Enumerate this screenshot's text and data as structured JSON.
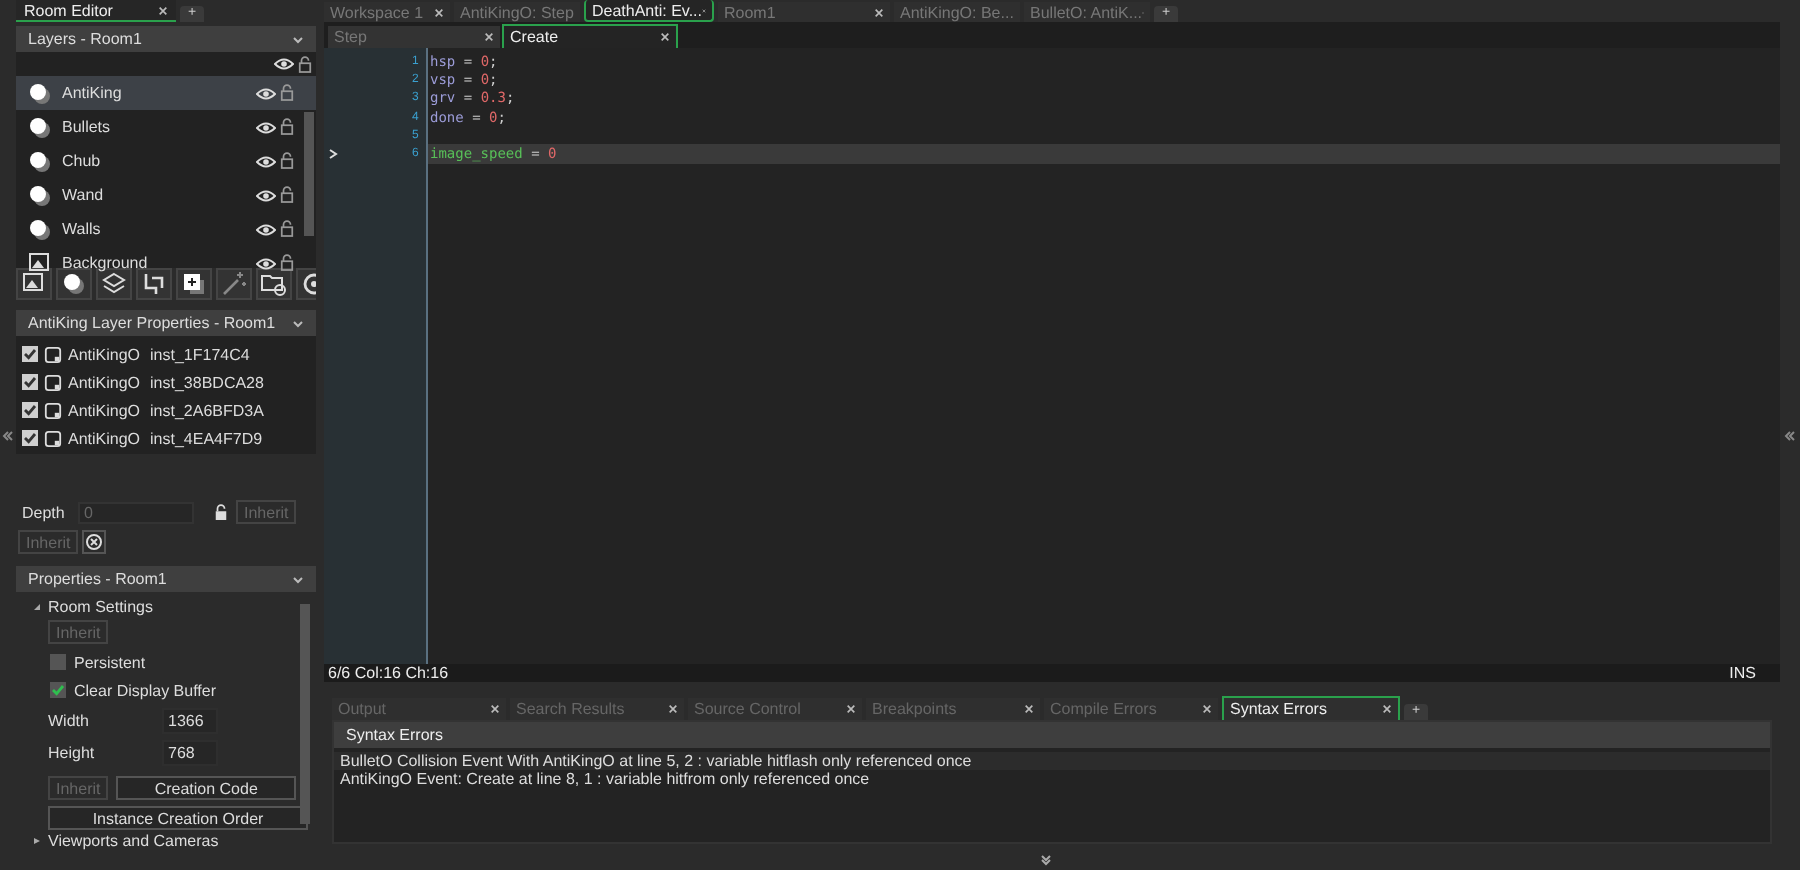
{
  "left_tabs": [
    {
      "label": "Room Editor",
      "selected": true
    },
    {
      "label": "+",
      "kind": "add"
    }
  ],
  "layers": {
    "title": "Layers - Room1",
    "items": [
      {
        "name": "AntiKing",
        "kind": "instance",
        "selected": true
      },
      {
        "name": "Bullets",
        "kind": "instance",
        "selected": false
      },
      {
        "name": "Chub",
        "kind": "instance",
        "selected": false
      },
      {
        "name": "Wand",
        "kind": "instance",
        "selected": false
      },
      {
        "name": "Walls",
        "kind": "instance",
        "selected": false
      },
      {
        "name": "Background",
        "kind": "background",
        "selected": false
      }
    ]
  },
  "layer_properties": {
    "title": "AntiKing Layer Properties - Room1",
    "instances": [
      {
        "checked": true,
        "object": "AntiKingO",
        "id": "inst_1F174C4"
      },
      {
        "checked": true,
        "object": "AntiKingO",
        "id": "inst_38BDCA28"
      },
      {
        "checked": true,
        "object": "AntiKingO",
        "id": "inst_2A6BFD3A"
      },
      {
        "checked": true,
        "object": "AntiKingO",
        "id": "inst_4EA4F7D9"
      }
    ],
    "depth_label": "Depth",
    "depth_placeholder": "0",
    "inherit_buttons": [
      "Inherit",
      "Inherit"
    ]
  },
  "properties": {
    "title": "Properties - Room1",
    "section": "Room Settings",
    "inherit": "Inherit",
    "options": [
      {
        "label": "Persistent",
        "checked": false
      },
      {
        "label": "Clear Display Buffer",
        "checked": true
      }
    ],
    "fields": [
      {
        "label": "Width",
        "value": "1366"
      },
      {
        "label": "Height",
        "value": "768"
      }
    ],
    "inherit2": "Inherit",
    "creation_code": "Creation Code",
    "instance_order": "Instance Creation Order",
    "next_section": "Viewports and Cameras"
  },
  "editor_tabs": [
    {
      "label": "Workspace 1",
      "selected": false
    },
    {
      "label": "AntiKingO: Step",
      "selected": false
    },
    {
      "label": "DeathAnti: Ev...",
      "selected": true
    },
    {
      "label": "Room1",
      "selected": false
    },
    {
      "label": "AntiKingO: Be...",
      "selected": false
    },
    {
      "label": "BulletO: AntiK...",
      "selected": false
    }
  ],
  "editor_add": "+",
  "event_tabs": [
    {
      "label": "Step",
      "selected": false
    },
    {
      "label": "Create",
      "selected": true
    }
  ],
  "code": [
    {
      "number": "1",
      "current": false,
      "tokens": [
        {
          "text": "hsp",
          "kind": "var"
        },
        {
          "text": " = ",
          "kind": "op"
        },
        {
          "text": "0",
          "kind": "num"
        },
        {
          "text": ";",
          "kind": "op"
        }
      ]
    },
    {
      "number": "2",
      "current": false,
      "tokens": [
        {
          "text": "vsp",
          "kind": "var"
        },
        {
          "text": " = ",
          "kind": "op"
        },
        {
          "text": "0",
          "kind": "num"
        },
        {
          "text": ";",
          "kind": "op"
        }
      ]
    },
    {
      "number": "3",
      "current": false,
      "tokens": [
        {
          "text": "grv",
          "kind": "var"
        },
        {
          "text": " = ",
          "kind": "op"
        },
        {
          "text": "0.3",
          "kind": "num"
        },
        {
          "text": ";",
          "kind": "op"
        }
      ]
    },
    {
      "number": "4",
      "current": false,
      "tokens": [
        {
          "text": "done",
          "kind": "var"
        },
        {
          "text": " = ",
          "kind": "op"
        },
        {
          "text": "0",
          "kind": "num"
        },
        {
          "text": ";",
          "kind": "op"
        }
      ]
    },
    {
      "number": "5",
      "current": false
    },
    {
      "number": "6",
      "current": true,
      "tokens": [
        {
          "text": "image_speed",
          "kind": "builtin"
        },
        {
          "text": " = ",
          "kind": "op"
        },
        {
          "text": "0",
          "kind": "num"
        }
      ]
    }
  ],
  "status_bar": {
    "position": "6/6 Col:16 Ch:16",
    "mode": "INS"
  },
  "output_tabs": [
    {
      "label": "Output",
      "selected": false
    },
    {
      "label": "Search Results",
      "selected": false
    },
    {
      "label": "Source Control",
      "selected": false
    },
    {
      "label": "Breakpoints",
      "selected": false
    },
    {
      "label": "Compile Errors",
      "selected": false
    },
    {
      "label": "Syntax Errors",
      "selected": true
    }
  ],
  "output_add": "+",
  "syntax_errors": {
    "title": "Syntax Errors",
    "messages": [
      "BulletO Collision Event With AntiKingO at line 5, 2 : variable hitflash only referenced once",
      "AntiKingO Event: Create at line 8, 1 : variable hitfrom only referenced once"
    ]
  }
}
